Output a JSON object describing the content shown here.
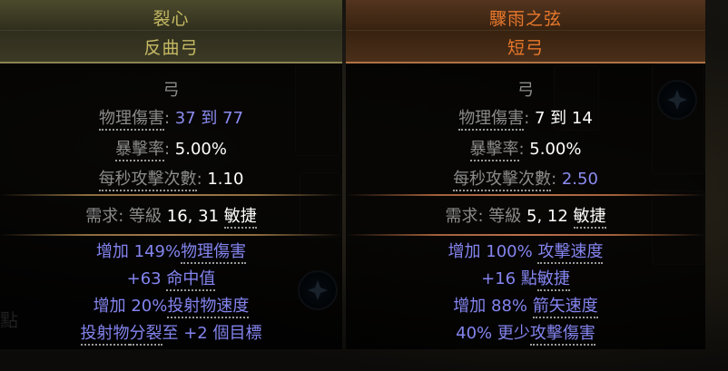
{
  "left_item": {
    "name": "裂心",
    "base_type": "反曲弓",
    "item_class": "弓",
    "props": {
      "physical_damage_label": "物理傷害",
      "physical_damage_value": "37 到 77",
      "crit_label": "暴擊率",
      "crit_value": "5.00%",
      "aps_label": "每秒攻擊次數",
      "aps_value": "1.10"
    },
    "requirements": {
      "label": "需求",
      "level_label": "等級",
      "level_value": "16",
      "dex_value": "31",
      "dex_label": "敏捷"
    },
    "mods": {
      "mod1_prefix": "增加 149%",
      "mod1_keyword": "物理傷害",
      "mod2_prefix": "+63 ",
      "mod2_keyword": "命中值",
      "mod3_prefix": "增加 20%",
      "mod3_keyword": "投射物速度",
      "mod4_kw1": "投射物",
      "mod4_kw2": "分裂",
      "mod4_rest": "至 +2 個目標"
    }
  },
  "right_item": {
    "name": "驟雨之弦",
    "base_type": "短弓",
    "item_class": "弓",
    "props": {
      "physical_damage_label": "物理傷害",
      "physical_damage_value": "7 到 14",
      "crit_label": "暴擊率",
      "crit_value": "5.00%",
      "aps_label": "每秒攻擊次數",
      "aps_value": "2.50"
    },
    "requirements": {
      "label": "需求",
      "level_label": "等級",
      "level_value": "5",
      "dex_value": "12",
      "dex_label": "敏捷"
    },
    "mods": {
      "mod1_prefix": "增加 100% ",
      "mod1_keyword": "攻擊速度",
      "mod2_prefix": "+16 點",
      "mod2_keyword": "敏捷",
      "mod3_prefix": "增加 88% ",
      "mod3_keyword": "箭矢速度",
      "mod4_prefix": "40% 更少",
      "mod4_keyword": "攻擊傷害"
    }
  },
  "background": {
    "fragment_text": "點"
  },
  "colors": {
    "unique_name_left": "#c5b964",
    "unique_name_right": "#e8782c",
    "magic_mod": "#8484f0",
    "property_label": "#8b8b8b"
  }
}
